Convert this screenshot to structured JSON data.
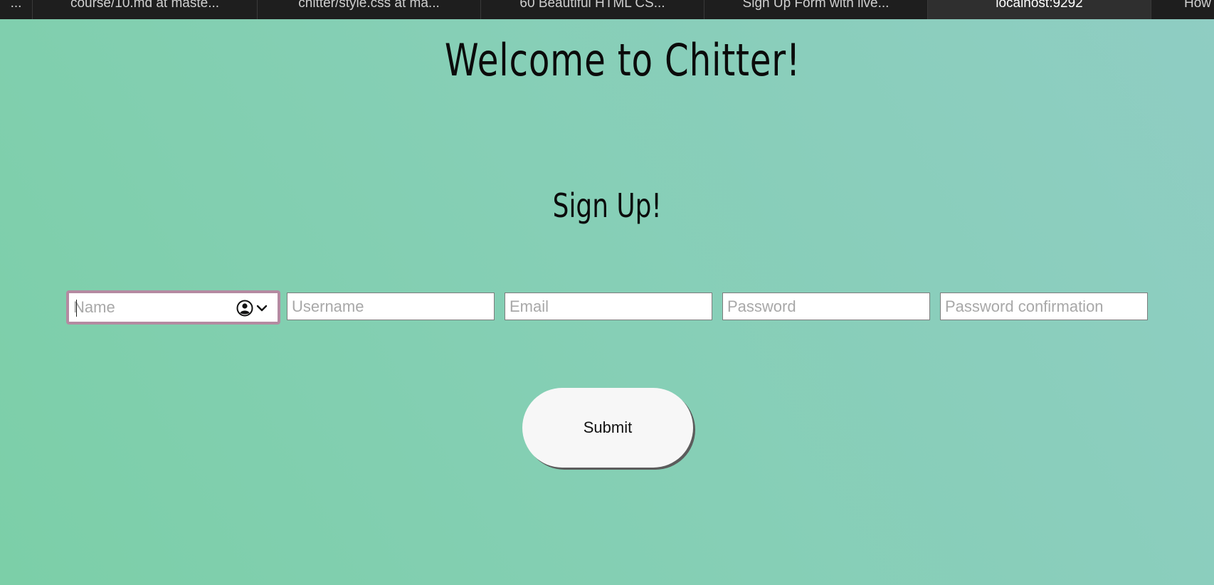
{
  "browser": {
    "tabs": [
      {
        "label": "..."
      },
      {
        "label": "course/10.md at maste..."
      },
      {
        "label": "chitter/style.css at ma..."
      },
      {
        "label": "60 Beautiful HTML CS..."
      },
      {
        "label": "Sign Up Form with live..."
      },
      {
        "label": "localhost:9292"
      },
      {
        "label": "How"
      }
    ],
    "active_tab": 5
  },
  "page": {
    "title": "Welcome to Chitter!",
    "subtitle": "Sign Up!"
  },
  "form": {
    "name_placeholder": "Name",
    "username_placeholder": "Username",
    "email_placeholder": "Email",
    "password_placeholder": "Password",
    "password_confirmation_placeholder": "Password confirmation",
    "submit_label": "Submit"
  },
  "icons": {
    "autofill": "contact-autofill-icon",
    "chevron": "chevron-down-icon"
  },
  "colors": {
    "focus_ring": "#b48aa1",
    "background_start": "#7ccfa8",
    "background_end": "#8fcdc3"
  }
}
